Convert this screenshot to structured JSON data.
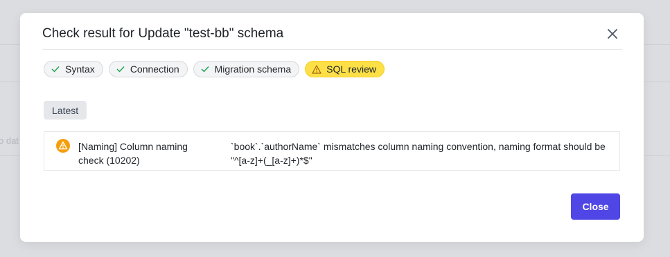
{
  "dialog": {
    "title": "Check result for Update \"test-bb\" schema",
    "close_icon": "close-icon"
  },
  "tabs": [
    {
      "label": "Syntax",
      "status": "success",
      "icon": "check-icon"
    },
    {
      "label": "Connection",
      "status": "success",
      "icon": "check-icon"
    },
    {
      "label": "Migration schema",
      "status": "success",
      "icon": "check-icon"
    },
    {
      "label": "SQL review",
      "status": "warning",
      "icon": "warning-triangle-icon"
    }
  ],
  "badge": {
    "label": "Latest"
  },
  "results": [
    {
      "status": "warning",
      "icon": "warning-circle-icon",
      "title": "[Naming] Column naming check (10202)",
      "message": "`book`.`authorName` mismatches column naming convention, naming format should be \"^[a-z]+(_[a-z]+)*$\""
    }
  ],
  "footer": {
    "close_label": "Close"
  },
  "background": {
    "partial_text": "o dat"
  },
  "colors": {
    "accent": "#4f46e5",
    "warning": "#f59e0b",
    "warning_tab": "#fde047",
    "success": "#16a34a"
  }
}
